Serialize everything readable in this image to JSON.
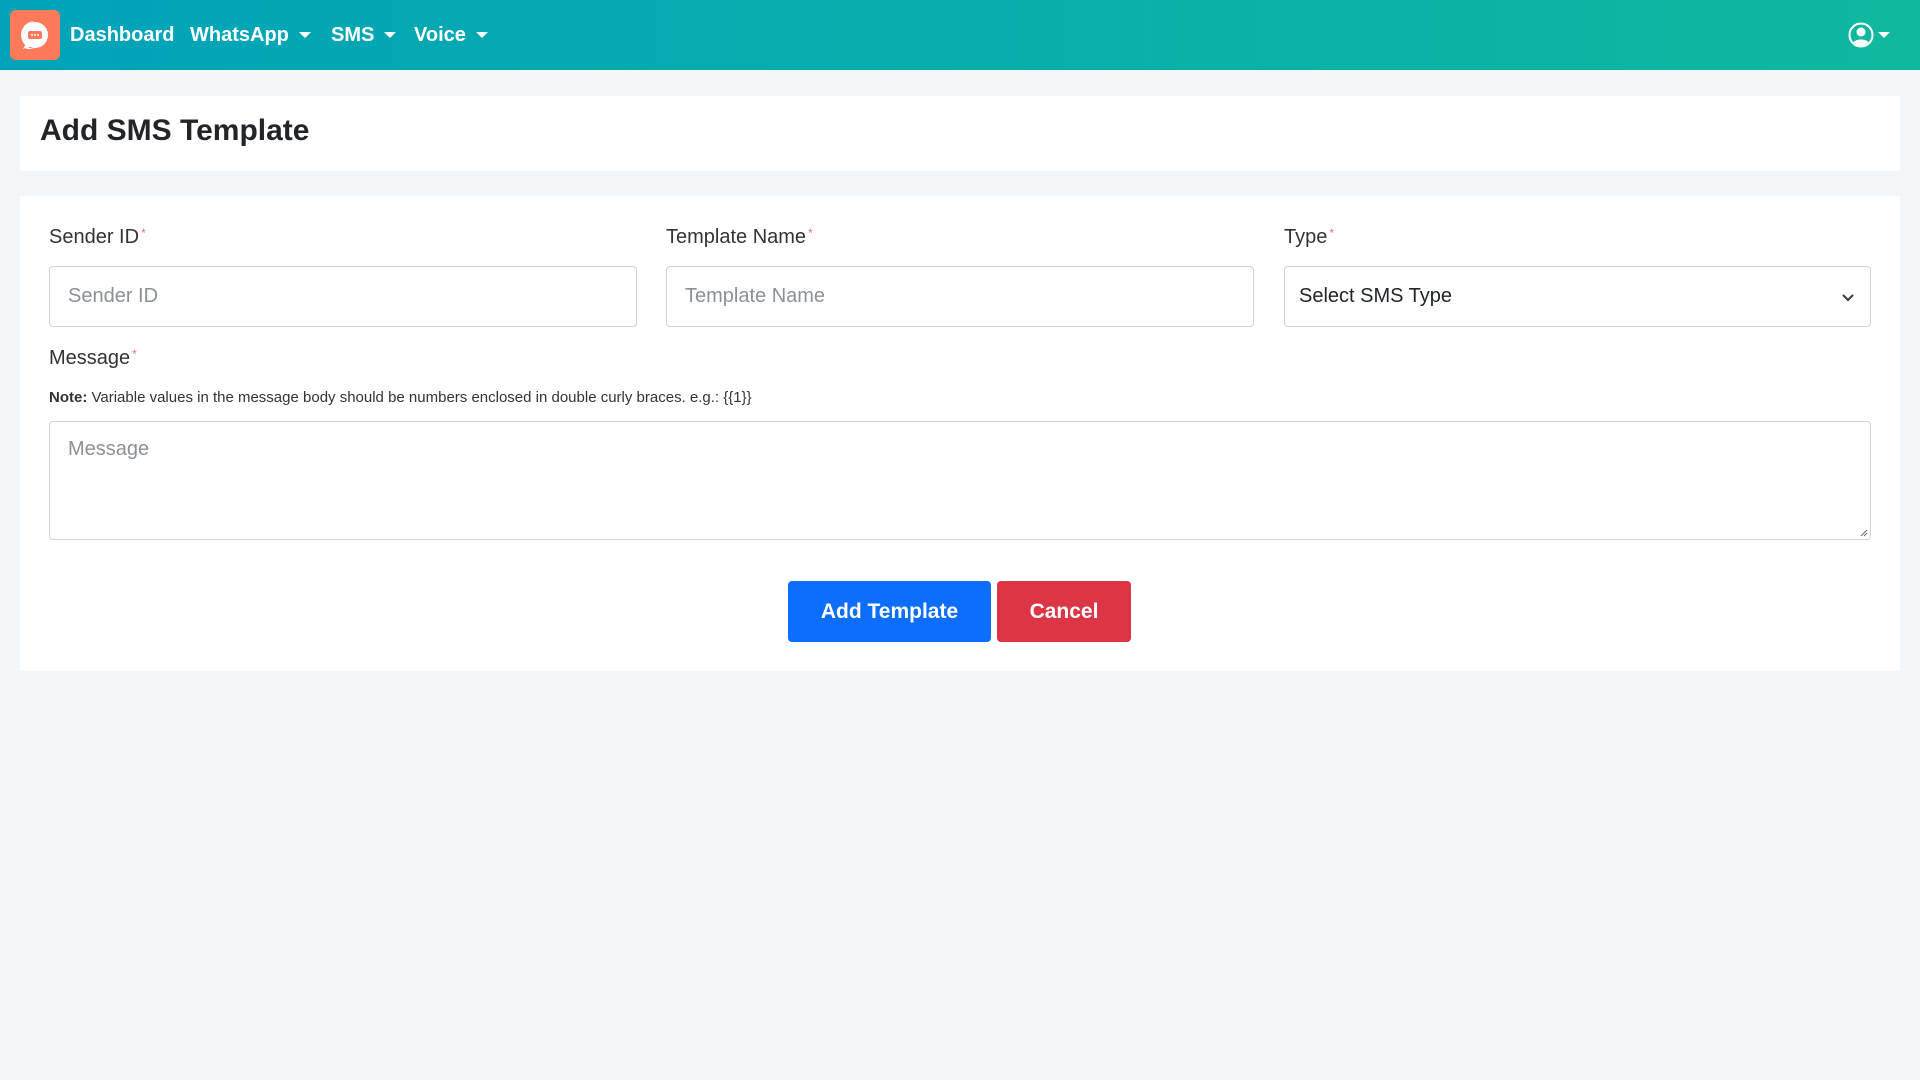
{
  "nav": {
    "items": [
      {
        "label": "Dashboard"
      },
      {
        "label": "WhatsApp"
      },
      {
        "label": "SMS"
      },
      {
        "label": "Voice"
      }
    ],
    "logo_icon": "chat-bubble-icon",
    "user_icon": "user-circle-icon"
  },
  "page": {
    "title": "Add SMS Template"
  },
  "form": {
    "sender_id": {
      "label": "Sender ID",
      "placeholder": "Sender ID",
      "required": "*"
    },
    "template_name": {
      "label": "Template Name",
      "placeholder": "Template Name",
      "required": "*"
    },
    "type": {
      "label": "Type",
      "selected": "Select SMS Type",
      "required": "*"
    },
    "message": {
      "label": "Message",
      "placeholder": "Message",
      "required": "*"
    },
    "note_bold": "Note:",
    "note_text": " Variable values in the message body should be numbers enclosed in double curly braces. e.g.: {{1}}",
    "submit_label": "Add Template",
    "cancel_label": "Cancel"
  },
  "colors": {
    "primary": "#0d6efd",
    "danger": "#dc3545",
    "logo": "#fa7a5a"
  }
}
